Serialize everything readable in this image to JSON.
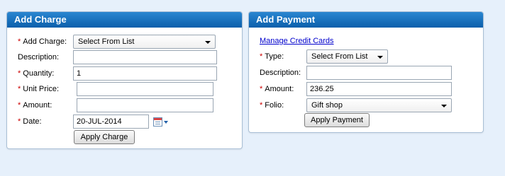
{
  "add_charge": {
    "title": "Add Charge",
    "add_charge_label": "Add Charge:",
    "add_charge_value": "Select From List",
    "description_label": "Description:",
    "description_value": "",
    "quantity_label": "Quantity:",
    "quantity_value": "1",
    "unit_price_label": "Unit Price:",
    "unit_price_value": "",
    "amount_label": "Amount:",
    "amount_value": "",
    "date_label": "Date:",
    "date_value": "20-JUL-2014",
    "apply_button": "Apply Charge",
    "required_mark": "*"
  },
  "add_payment": {
    "title": "Add Payment",
    "manage_link": "Manage Credit Cards",
    "type_label": "Type:",
    "type_value": "Select From List",
    "description_label": "Description:",
    "description_value": "",
    "amount_label": "Amount:",
    "amount_value": "236.25",
    "folio_label": "Folio:",
    "folio_value": "Gift shop",
    "apply_button": "Apply Payment",
    "required_mark": "*"
  },
  "icons": {
    "calendar": "calendar-icon",
    "dropdown": "chevron-down-icon"
  },
  "colors": {
    "header": "#1570c0",
    "required": "#cc0000",
    "link": "#0000cc",
    "background": "#e6f0fb"
  }
}
